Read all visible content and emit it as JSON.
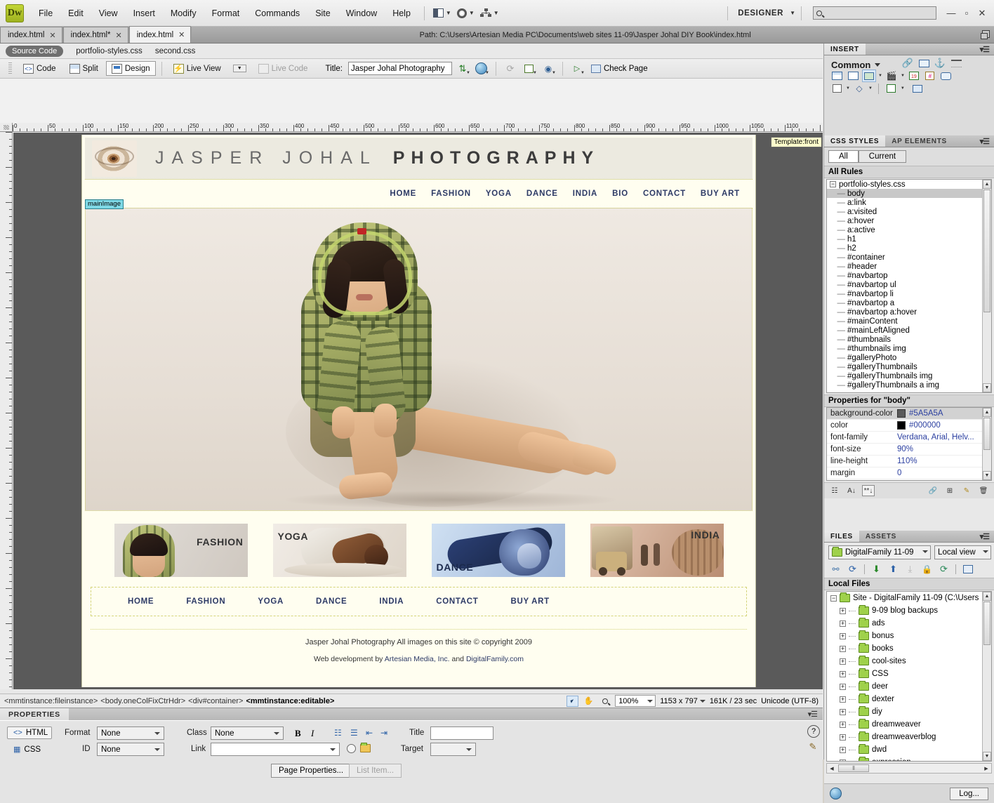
{
  "app": {
    "logo": "Dw",
    "menus": [
      "File",
      "Edit",
      "View",
      "Insert",
      "Modify",
      "Format",
      "Commands",
      "Site",
      "Window",
      "Help"
    ],
    "workspace_label": "DESIGNER",
    "search_placeholder": "",
    "window_buttons": {
      "minimize": "—",
      "maximize": "▫",
      "close": "✕"
    }
  },
  "doc_tabs": [
    {
      "label": "index.html",
      "close": "✕",
      "active": false
    },
    {
      "label": "index.html*",
      "close": "✕",
      "active": false
    },
    {
      "label": "index.html",
      "close": "✕",
      "active": true
    }
  ],
  "path_bar": {
    "text": "Path:  C:\\Users\\Artesian Media PC\\Documents\\web sites 11-09\\Jasper Johal DIY Book\\index.html"
  },
  "related_files": {
    "source_code": "Source Code",
    "files": [
      "portfolio-styles.css",
      "second.css"
    ]
  },
  "doc_toolbar": {
    "code": "Code",
    "split": "Split",
    "design": "Design",
    "live_view": "Live View",
    "live_code": "Live Code",
    "title_label": "Title:",
    "title_value": "Jasper Johal Photography",
    "check_page": "Check Page"
  },
  "rulers": {
    "h_labels": [
      "0",
      "50",
      "100",
      "150",
      "200",
      "250",
      "300",
      "350",
      "400",
      "450",
      "500",
      "550",
      "600",
      "650",
      "700",
      "750",
      "800",
      "850",
      "900",
      "950",
      "1000",
      "1050",
      "1100"
    ]
  },
  "canvas": {
    "template_badge": "Template:front",
    "main_image_tag": "mainImage"
  },
  "website": {
    "site_name_thin": "JASPER JOHAL",
    "site_name_bold": "PHOTOGRAPHY",
    "nav_top": [
      "HOME",
      "FASHION",
      "YOGA",
      "DANCE",
      "INDIA",
      "BIO",
      "CONTACT",
      "BUY ART"
    ],
    "nav_bottom": [
      "HOME",
      "FASHION",
      "YOGA",
      "DANCE",
      "INDIA",
      "CONTACT",
      "BUY ART"
    ],
    "thumbnails": [
      {
        "label": "FASHION",
        "align": "right"
      },
      {
        "label": "YOGA",
        "align": "left"
      },
      {
        "label": "DANCE",
        "align": "left-bottom"
      },
      {
        "label": "INDIA",
        "align": "right"
      }
    ],
    "footer_copyright": "Jasper Johal Photography All images on this site © copyright 2009",
    "footer_credit_pre": "Web development by ",
    "footer_credit_link1": "Artesian Media, Inc.",
    "footer_credit_mid": " and ",
    "footer_credit_link2": "DigitalFamily.com"
  },
  "status_bar": {
    "tag_selector": [
      "<mmtinstance:fileinstance>",
      "<body.oneColFixCtrHdr>",
      "<div#container>",
      "<mmtinstance:editable>"
    ],
    "zoom": "100%",
    "dimensions": "1153 x 797",
    "size_time": "161K / 23 sec",
    "encoding": "Unicode (UTF-8)"
  },
  "properties_panel": {
    "tab_label": "PROPERTIES",
    "html_btn": "HTML",
    "css_btn": "CSS",
    "format_label": "Format",
    "format_value": "None",
    "id_label": "ID",
    "id_value": "None",
    "class_label": "Class",
    "class_value": "None",
    "link_label": "Link",
    "link_value": "",
    "title_label": "Title",
    "title_value": "",
    "target_label": "Target",
    "target_value": "",
    "page_properties_btn": "Page Properties...",
    "list_item_btn": "List Item..."
  },
  "insert_panel": {
    "tab": "INSERT",
    "category": "Common",
    "icons_row1": [
      "hyperlink-break-icon",
      "email-link-icon",
      "named-anchor-icon",
      "horizontal-rule-icon"
    ],
    "icons_row2": [
      "table-icon",
      "insert-div-icon",
      "images-icon",
      "media-icon",
      "date-icon",
      "server-side-include-icon",
      "comment-icon"
    ],
    "icons_row3": [
      "templates-icon",
      "tag-chooser-icon",
      "spry-icon",
      "widget-browser-icon"
    ]
  },
  "css_panel": {
    "tabs": [
      "CSS STYLES",
      "AP ELEMENTS"
    ],
    "active_tab": "CSS STYLES",
    "mode_buttons": [
      "All",
      "Current"
    ],
    "active_mode": "All",
    "all_rules_label": "All Rules",
    "stylesheet": "portfolio-styles.css",
    "rules": [
      "body",
      "a:link",
      "a:visited",
      "a:hover",
      "a:active",
      "h1",
      "h2",
      "#container",
      "#header",
      "#navbartop",
      "#navbartop ul",
      "#navbartop li",
      "#navbartop a",
      "#navbartop a:hover",
      "#mainContent",
      "#mainLeftAligned",
      "#thumbnails",
      "#thumbnails img",
      "#galleryPhoto",
      "#galleryThumbnails",
      "#galleryThumbnails img",
      "#galleryThumbnails a img"
    ],
    "selected_rule": "body",
    "properties_header": "Properties for \"body\"",
    "properties": [
      {
        "name": "background-color",
        "value": "#5A5A5A",
        "swatch": "#5A5A5A"
      },
      {
        "name": "color",
        "value": "#000000",
        "swatch": "#000000"
      },
      {
        "name": "font-family",
        "value": "Verdana, Arial, Helv...",
        "swatch": ""
      },
      {
        "name": "font-size",
        "value": "90%",
        "swatch": ""
      },
      {
        "name": "line-height",
        "value": "110%",
        "swatch": ""
      },
      {
        "name": "margin",
        "value": "0",
        "swatch": ""
      }
    ],
    "footer_icons": [
      "show-category-view-icon",
      "show-list-view-icon",
      "show-only-set-properties-icon",
      "attach-style-sheet-icon",
      "new-css-rule-icon",
      "edit-rule-icon",
      "delete-rule-icon"
    ]
  },
  "files_panel": {
    "tabs": [
      "FILES",
      "ASSETS"
    ],
    "active_tab": "FILES",
    "site_combo": "DigitalFamily 11-09",
    "view_combo": "Local view",
    "toolbar_icons": [
      "connect-to-remote-icon",
      "refresh-icon",
      "get-files-icon",
      "put-files-icon",
      "check-out-icon",
      "check-in-icon",
      "synchronize-icon",
      "expand-collapse-icon"
    ],
    "local_files_header": "Local Files",
    "root": "Site - DigitalFamily 11-09 (C:\\Users",
    "folders": [
      "9-09 blog backups",
      "ads",
      "bonus",
      "books",
      "cool-sites",
      "CSS",
      "deer",
      "dexter",
      "diy",
      "dreamweaver",
      "dreamweaverblog",
      "dwd",
      "expression"
    ],
    "log_button": "Log..."
  }
}
